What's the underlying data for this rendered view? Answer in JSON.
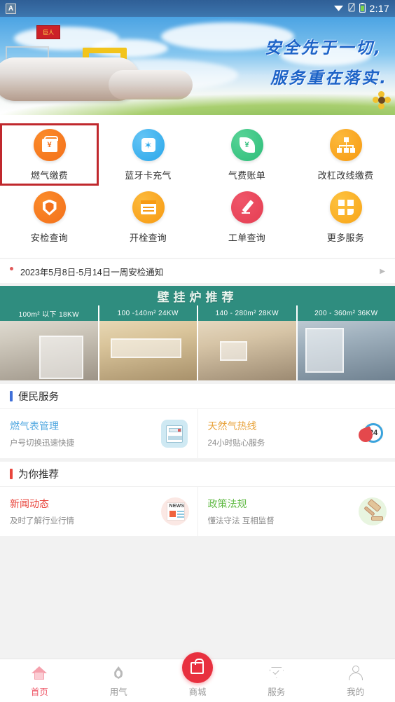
{
  "statusbar": {
    "app_badge": "A",
    "time": "2:17",
    "icons": [
      "wifi-icon",
      "signal-icon",
      "battery-icon"
    ]
  },
  "banner": {
    "line1": "安全先于一切,",
    "line2": "服务重在落实.",
    "flag_label": "巨人"
  },
  "grid": {
    "items": [
      {
        "label": "燃气缴费",
        "icon": "wallet-yen-icon",
        "color": "#f3701b",
        "selected": true
      },
      {
        "label": "蓝牙卡充气",
        "icon": "bluetooth-icon",
        "color": "#2aa7ea",
        "selected": false
      },
      {
        "label": "气费账单",
        "icon": "leaf-yen-icon",
        "color": "#2dbd7a",
        "selected": false
      },
      {
        "label": "改杠改线缴费",
        "icon": "network-icon",
        "color": "#f79a12",
        "selected": false
      },
      {
        "label": "安检查询",
        "icon": "shield-icon",
        "color": "#f3701b",
        "selected": false
      },
      {
        "label": "开栓查询",
        "icon": "calendar-icon",
        "color": "#f79a12",
        "selected": false
      },
      {
        "label": "工单查询",
        "icon": "pencil-icon",
        "color": "#e53e52",
        "selected": false
      },
      {
        "label": "更多服务",
        "icon": "grid-more-icon",
        "color": "#f8a417",
        "selected": false
      }
    ]
  },
  "notice": {
    "text": "2023年5月8日-5月14日一周安检通知",
    "arrow": "▶"
  },
  "ad": {
    "title": "壁挂炉推荐",
    "cells": [
      {
        "caption": "100m² 以下  18KW"
      },
      {
        "caption": "100 -140m²  24KW"
      },
      {
        "caption": "140 - 280m²  28KW"
      },
      {
        "caption": "200 - 360m²  36KW"
      }
    ]
  },
  "sections": [
    {
      "title": "便民服务",
      "bar_color": "#3f6fd8",
      "cells": [
        {
          "title": "燃气表管理",
          "subtitle": "户号切换迅速快捷",
          "title_color": "#52a8e0",
          "icon": "gas-meter-icon"
        },
        {
          "title": "天然气热线",
          "subtitle": "24小时贴心服务",
          "title_color": "#e8a33c",
          "icon": "hotline-24-icon",
          "badge": "24"
        }
      ]
    },
    {
      "title": "为你推荐",
      "bar_color": "#e8453c",
      "cells": [
        {
          "title": "新闻动态",
          "subtitle": "及时了解行业行情",
          "title_color": "#e8453c",
          "icon": "news-icon",
          "badge": "NEWS"
        },
        {
          "title": "政策法规",
          "subtitle": "懂法守法 互相监督",
          "title_color": "#62bb46",
          "icon": "gavel-icon"
        }
      ]
    }
  ],
  "tabbar": {
    "items": [
      {
        "label": "首页",
        "icon": "home-icon",
        "active": true
      },
      {
        "label": "用气",
        "icon": "flame-icon",
        "active": false
      },
      {
        "label": "商城",
        "icon": "shop-bag-icon",
        "active": false
      },
      {
        "label": "服务",
        "icon": "shield-check-icon",
        "active": false
      },
      {
        "label": "我的",
        "icon": "person-icon",
        "active": false
      }
    ],
    "accent_color": "#ef5a6a"
  }
}
